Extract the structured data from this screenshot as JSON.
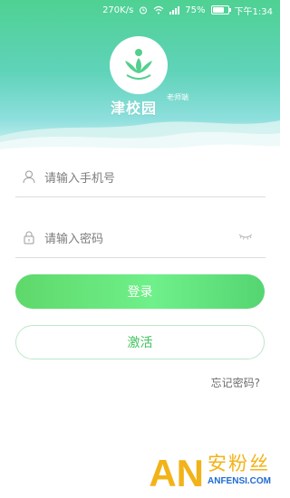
{
  "status_bar": {
    "speed": "270K/s",
    "battery_pct": "75%",
    "time": "下午1:34"
  },
  "brand": {
    "name": "津校园",
    "sub": "老师端"
  },
  "form": {
    "phone_placeholder": "请输入手机号",
    "password_placeholder": "请输入密码"
  },
  "buttons": {
    "login": "登录",
    "activate": "激活"
  },
  "links": {
    "forgot": "忘记密码?"
  },
  "watermark": {
    "an": "AN",
    "cn": "安粉丝",
    "en": "ANFENSI.COM"
  },
  "colors": {
    "accent": "#4fd193",
    "button_green": "#5fd86a",
    "outline_green": "#bde8c9"
  }
}
